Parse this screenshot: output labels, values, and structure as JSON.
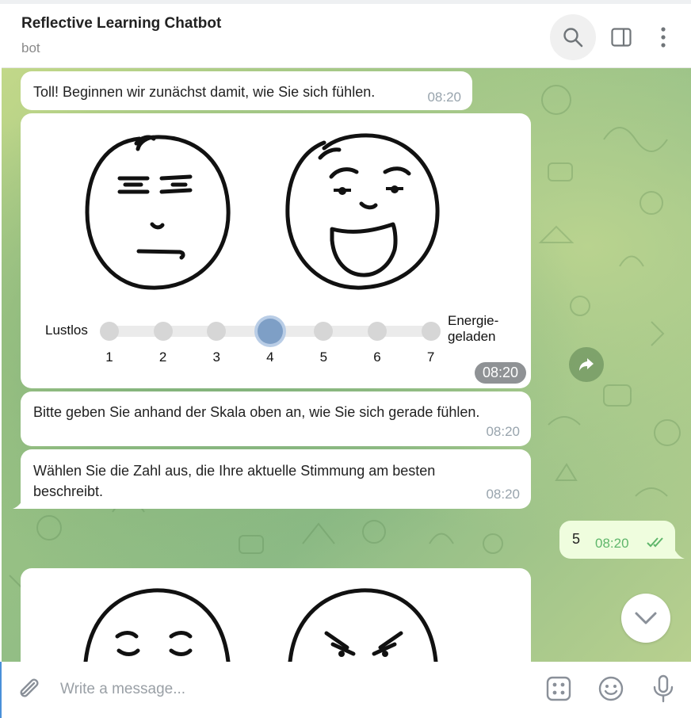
{
  "header": {
    "title": "Reflective Learning Chatbot",
    "subtitle": "bot",
    "icons": [
      "search-icon",
      "sidebar-toggle-icon",
      "more-vertical-icon"
    ]
  },
  "messages": {
    "m1": {
      "text": "Toll! Beginnen wir zunächst damit, wie Sie sich fühlen.",
      "time": "08:20"
    },
    "image": {
      "time": "08:20",
      "scale_left_label": "Lustlos",
      "scale_right_label_1": "Energie-",
      "scale_right_label_2": "geladen",
      "scale_numbers": [
        "1",
        "2",
        "3",
        "4",
        "5",
        "6",
        "7"
      ],
      "highlighted_value": "4"
    },
    "m3": {
      "text": "Bitte geben Sie anhand der Skala oben an, wie Sie sich gerade fühlen.",
      "time": "08:20"
    },
    "m4": {
      "text": "Wählen Sie die Zahl aus, die Ihre aktuelle Stimmung am besten beschreibt.",
      "time": "08:20"
    },
    "outgoing": {
      "text": "5",
      "time": "08:20",
      "status": "read"
    }
  },
  "composer": {
    "placeholder": "Write a message...",
    "icons": [
      "attach-icon",
      "commands-icon",
      "emoji-icon",
      "microphone-icon"
    ]
  },
  "colors": {
    "outgoing_bubble": "#effdde",
    "read_ticks": "#5fb66b",
    "accent": "#4a90d9"
  }
}
